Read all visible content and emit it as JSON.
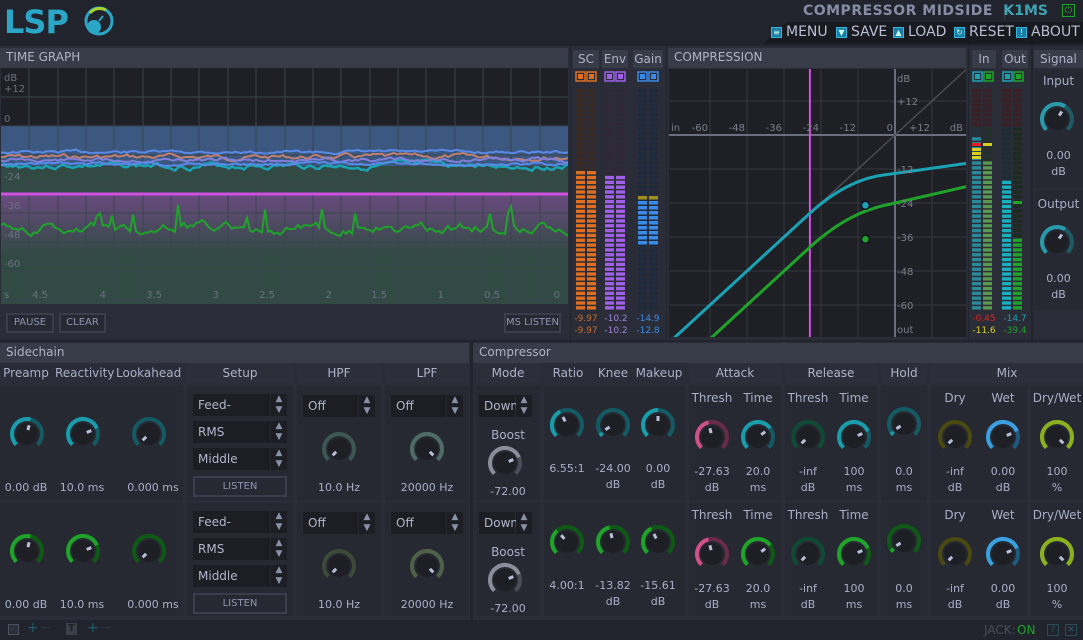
{
  "header": {
    "logo": "LSP",
    "plugin_name": "COMPRESSOR MIDSIDE",
    "plugin_id": "K1MS",
    "menu": [
      {
        "label": "MENU",
        "icon": "menu-icon"
      },
      {
        "label": "SAVE",
        "icon": "save-icon"
      },
      {
        "label": "LOAD",
        "icon": "load-icon"
      },
      {
        "label": "RESET",
        "icon": "reset-icon"
      },
      {
        "label": "ABOUT",
        "icon": "about-icon"
      }
    ]
  },
  "time_graph": {
    "title": "TIME GRAPH",
    "y_unit": "dB",
    "y_ticks": [
      "+12",
      "0",
      "-24",
      "-36",
      "-48",
      "-60"
    ],
    "x_unit": "s",
    "x_ticks": [
      "4.5",
      "4",
      "3.5",
      "3",
      "2.5",
      "2",
      "1.5",
      "1",
      "0.5",
      "0"
    ],
    "buttons": {
      "pause": "PAUSE",
      "clear": "CLEAR",
      "ms_listen": "MS LISTEN"
    }
  },
  "meters": {
    "sc": {
      "label": "SC",
      "values": [
        "-9.97",
        "-9.97"
      ],
      "color": "#e07020"
    },
    "env": {
      "label": "Env",
      "values": [
        "-10.2",
        "-10.2"
      ],
      "color": "#a060e8"
    },
    "gain": {
      "label": "Gain",
      "values": [
        "-14.9",
        "-12.8"
      ],
      "color": "#3a8ae8"
    },
    "in": {
      "label": "In",
      "values": [
        "-0.45",
        "-11.6"
      ],
      "colors": [
        "#e02020",
        "#d8d020"
      ]
    },
    "out": {
      "label": "Out",
      "values": [
        "-14.7",
        "-39.4"
      ],
      "colors": [
        "#1fa0b0",
        "#1fa02a"
      ]
    }
  },
  "compression_graph": {
    "title": "COMPRESSION",
    "x_label": "in",
    "x_unit": "dB",
    "x_ticks": [
      "-60",
      "-48",
      "-36",
      "-24",
      "-12",
      "0",
      "+12"
    ],
    "y_unit": "dB",
    "y_label": "out",
    "y_ticks": [
      "+12",
      "0",
      "-12",
      "-24",
      "-36",
      "-48",
      "-60"
    ]
  },
  "signal": {
    "title": "Signal",
    "input": {
      "label": "Input",
      "value": "0.00",
      "unit": "dB"
    },
    "output": {
      "label": "Output",
      "value": "0.00",
      "unit": "dB"
    }
  },
  "sidechain": {
    "title": "Sidechain",
    "headers": {
      "preamp": "Preamp",
      "reactivity": "Reactivity",
      "lookahead": "Lookahead",
      "setup": "Setup",
      "hpf": "HPF",
      "lpf": "LPF"
    },
    "rows": [
      {
        "preamp": "0.00 dB",
        "reactivity": "10.0 ms",
        "lookahead": "0.000 ms",
        "type": "Feed-forward",
        "mode": "RMS",
        "source": "Middle",
        "listen": "LISTEN",
        "hpf_mode": "Off",
        "hpf": "10.0 Hz",
        "lpf_mode": "Off",
        "lpf": "20000 Hz"
      },
      {
        "preamp": "0.00 dB",
        "reactivity": "10.0 ms",
        "lookahead": "0.000 ms",
        "type": "Feed-forward",
        "mode": "RMS",
        "source": "Middle",
        "listen": "LISTEN",
        "hpf_mode": "Off",
        "hpf": "10.0 Hz",
        "lpf_mode": "Off",
        "lpf": "20000 Hz"
      }
    ]
  },
  "compressor": {
    "title": "Compressor",
    "headers": {
      "mode": "Mode",
      "ratio": "Ratio",
      "knee": "Knee",
      "makeup": "Makeup",
      "attack": "Attack",
      "release": "Release",
      "hold": "Hold",
      "mix": "Mix"
    },
    "sub": {
      "thresh": "Thresh",
      "time": "Time",
      "boost": "Boost",
      "dry": "Dry",
      "wet": "Wet",
      "drywet": "Dry/Wet"
    },
    "rows": [
      {
        "mode": "Down",
        "boost": "-72.00",
        "ratio": "6.55:1",
        "knee": "-24.00",
        "knee_unit": "dB",
        "makeup": "0.00",
        "makeup_unit": "dB",
        "att_thresh": "-27.63",
        "att_thresh_unit": "dB",
        "att_time": "20.0",
        "att_time_unit": "ms",
        "rel_thresh": "-inf",
        "rel_thresh_unit": "dB",
        "rel_time": "100",
        "rel_time_unit": "ms",
        "hold": "0.0",
        "hold_unit": "ms",
        "dry": "-inf",
        "dry_unit": "dB",
        "wet": "0.00",
        "wet_unit": "dB",
        "drywet": "100",
        "drywet_unit": "%"
      },
      {
        "mode": "Down",
        "boost": "-72.00",
        "ratio": "4.00:1",
        "knee": "-13.82",
        "knee_unit": "dB",
        "makeup": "-15.61",
        "makeup_unit": "dB",
        "att_thresh": "-27.63",
        "att_thresh_unit": "dB",
        "att_time": "20.0",
        "att_time_unit": "ms",
        "rel_thresh": "-inf",
        "rel_thresh_unit": "dB",
        "rel_time": "100",
        "rel_time_unit": "ms",
        "hold": "0.0",
        "hold_unit": "ms",
        "dry": "-inf",
        "dry_unit": "dB",
        "wet": "0.00",
        "wet_unit": "dB",
        "drywet": "100",
        "drywet_unit": "%"
      }
    ]
  },
  "status": {
    "jack_label": "JACK:",
    "jack_state": "ON"
  },
  "colors": {
    "middle": "#1aa3b5",
    "side": "#1fa32a",
    "threshold": "#d050e0",
    "accent": "#2ba6c6"
  }
}
